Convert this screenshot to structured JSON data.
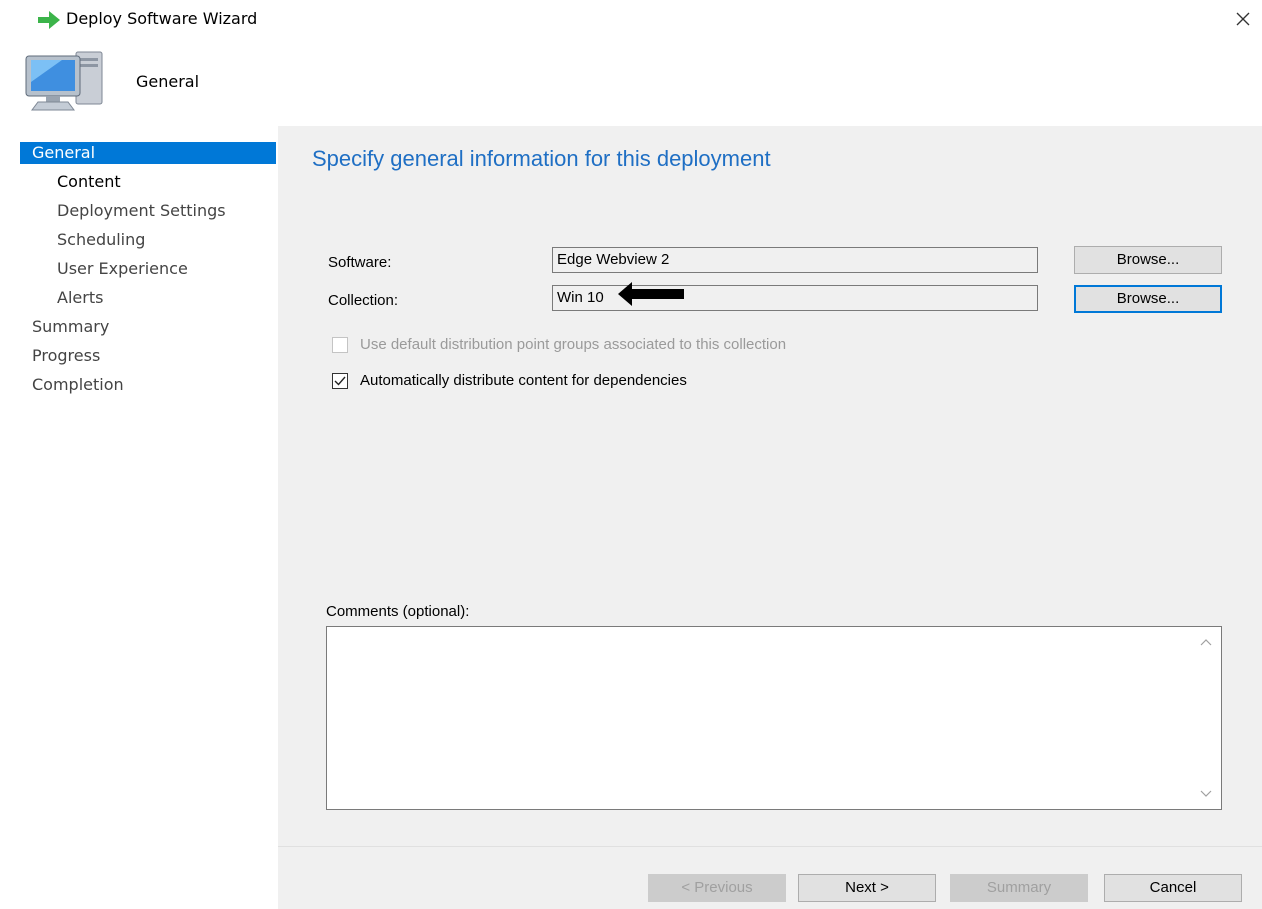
{
  "window": {
    "title": "Deploy Software Wizard",
    "close_icon": "close-icon"
  },
  "header": {
    "title": "General",
    "icon": "computer-monitor-icon"
  },
  "nav": {
    "items": [
      {
        "label": "General",
        "active": true
      },
      {
        "label": "Content",
        "sub": true,
        "bold": true
      },
      {
        "label": "Deployment Settings",
        "sub": true
      },
      {
        "label": "Scheduling",
        "sub": true
      },
      {
        "label": "User Experience",
        "sub": true
      },
      {
        "label": "Alerts",
        "sub": true
      },
      {
        "label": "Summary"
      },
      {
        "label": "Progress"
      },
      {
        "label": "Completion"
      }
    ]
  },
  "main": {
    "heading": "Specify general information for this deployment",
    "software": {
      "label": "Software:",
      "value": "Edge Webview 2",
      "browse_label": "Browse..."
    },
    "collection": {
      "label": "Collection:",
      "value": "Win 10",
      "browse_label": "Browse..."
    },
    "use_default_dp": {
      "label": "Use default distribution point groups associated to this collection",
      "checked": false,
      "disabled": true
    },
    "auto_distribute": {
      "label": "Automatically distribute content for dependencies",
      "checked": true
    },
    "comments": {
      "label": "Comments (optional):",
      "value": ""
    }
  },
  "footer": {
    "previous_label": "< Previous",
    "next_label": "Next >",
    "summary_label": "Summary",
    "cancel_label": "Cancel"
  },
  "colors": {
    "accent": "#0078d7",
    "heading": "#1f6fc4",
    "panel": "#f0f0f0"
  }
}
